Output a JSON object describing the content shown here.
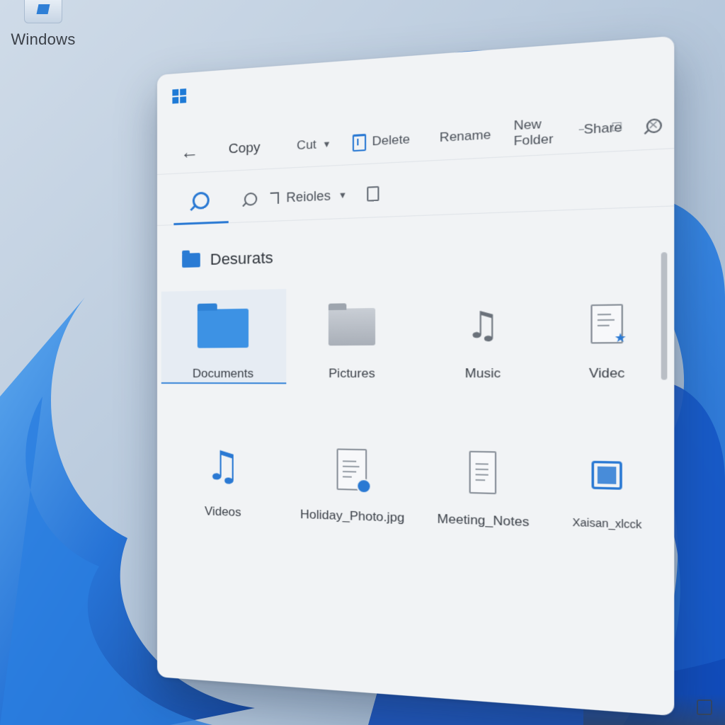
{
  "desktop": {
    "icon_label": "Windows"
  },
  "window": {
    "commands": {
      "copy": "Copy",
      "cut": "Cut",
      "delete": "Delete",
      "rename": "Rename",
      "new_folder": "New Folder",
      "share": "Share"
    },
    "subbar": {
      "sort_label": "Reioles"
    },
    "breadcrumb": "Desurats",
    "items": [
      {
        "label": "Documents",
        "icon": "folder-icon",
        "selected": true
      },
      {
        "label": "Pictures",
        "icon": "folder-icon"
      },
      {
        "label": "Music",
        "icon": "music-note-icon"
      },
      {
        "label": "Videc",
        "icon": "document-star-icon"
      },
      {
        "label": "Videos",
        "icon": "music-note-icon"
      },
      {
        "label": "Holiday_Photo.jpg",
        "icon": "image-document-icon"
      },
      {
        "label": "Meeting_Notes",
        "icon": "document-icon"
      },
      {
        "label": "Xaisan_xlcck",
        "icon": "frame-icon"
      }
    ]
  },
  "colors": {
    "accent": "#2a79d3",
    "window_bg": "#f1f3f5",
    "wallpaper_blue": "#1f6fd6"
  }
}
